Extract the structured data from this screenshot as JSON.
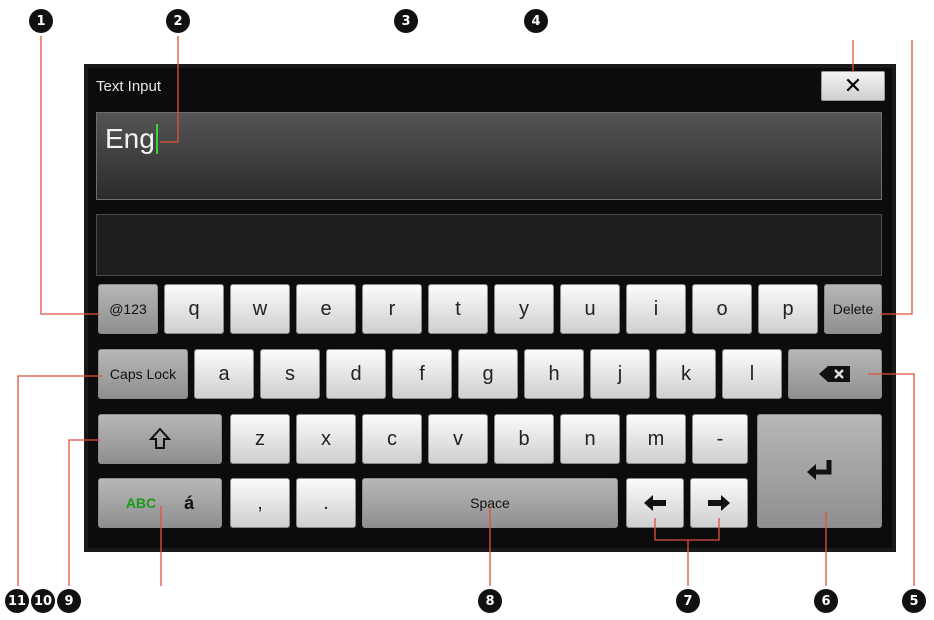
{
  "window": {
    "title": "Text Input"
  },
  "input": {
    "value": "Eng"
  },
  "callouts": [
    "1",
    "2",
    "3",
    "4",
    "5",
    "6",
    "7",
    "8",
    "9",
    "10",
    "11"
  ],
  "keys": {
    "symbols": "@123",
    "row1": [
      "q",
      "w",
      "e",
      "r",
      "t",
      "y",
      "u",
      "i",
      "o",
      "p"
    ],
    "delete": "Delete",
    "caps": "Caps Lock",
    "row2": [
      "a",
      "s",
      "d",
      "f",
      "g",
      "h",
      "j",
      "k",
      "l"
    ],
    "row3": [
      "z",
      "x",
      "c",
      "v",
      "b",
      "n",
      "m",
      "-"
    ],
    "abc": "ABC",
    "accent": "á",
    "comma": ",",
    "period": ".",
    "space": "Space"
  },
  "icons": {
    "close": "close-icon",
    "shift": "shift-icon",
    "backspace": "backspace-icon",
    "enter": "enter-icon",
    "left": "arrow-left-icon",
    "right": "arrow-right-icon"
  }
}
